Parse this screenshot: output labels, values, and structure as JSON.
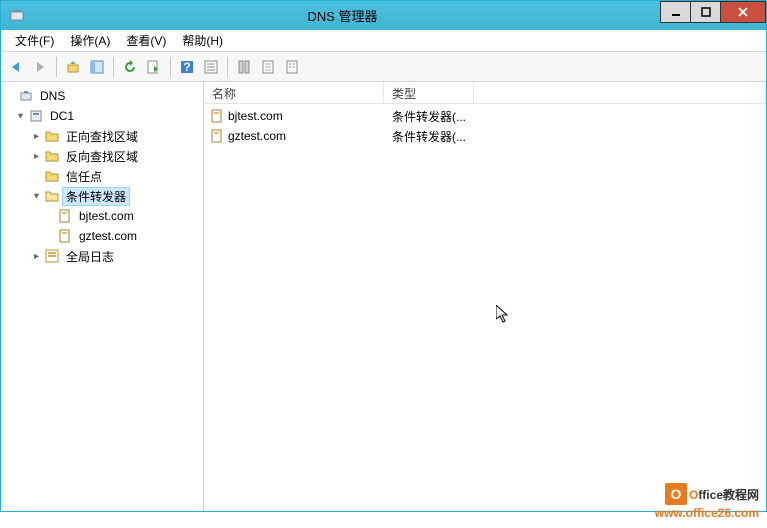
{
  "window": {
    "title": "DNS 管理器"
  },
  "menubar": {
    "file": "文件(F)",
    "action": "操作(A)",
    "view": "查看(V)",
    "help": "帮助(H)"
  },
  "tree": {
    "root": "DNS",
    "server": "DC1",
    "forward": "正向查找区域",
    "reverse": "反向查找区域",
    "trust": "信任点",
    "conditional": "条件转发器",
    "cf1": "bjtest.com",
    "cf2": "gztest.com",
    "globallog": "全局日志"
  },
  "list": {
    "col_name": "名称",
    "col_type": "类型",
    "rows": [
      {
        "name": "bjtest.com",
        "type": "条件转发器(..."
      },
      {
        "name": "gztest.com",
        "type": "条件转发器(..."
      }
    ]
  },
  "watermark": {
    "line1_prefix": "O",
    "line1_rest": "ffice教程网",
    "line2": "www.office26.com"
  }
}
